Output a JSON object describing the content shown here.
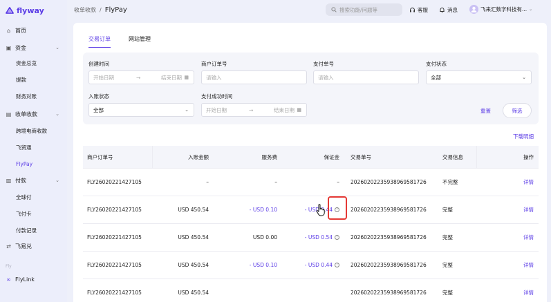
{
  "app": {
    "logo_text": "flyway"
  },
  "sidebar": {
    "items": [
      {
        "label": "首页",
        "icon": "home-icon",
        "kind": "top"
      },
      {
        "label": "资金",
        "icon": "wallet-icon",
        "kind": "group"
      },
      {
        "label": "资金总览",
        "kind": "sub"
      },
      {
        "label": "提款",
        "kind": "sub"
      },
      {
        "label": "财务对账",
        "kind": "sub"
      },
      {
        "label": "收单收款",
        "icon": "receipt-icon",
        "kind": "group"
      },
      {
        "label": "跨境电商收款",
        "kind": "sub"
      },
      {
        "label": "飞贸通",
        "kind": "sub"
      },
      {
        "label": "FlyPay",
        "kind": "sub",
        "active": true
      },
      {
        "label": "付款",
        "icon": "payment-icon",
        "kind": "group"
      },
      {
        "label": "全球付",
        "kind": "sub"
      },
      {
        "label": "飞付卡",
        "kind": "sub"
      },
      {
        "label": "付款记录",
        "kind": "sub"
      },
      {
        "label": "飞易兑",
        "icon": "exchange-icon",
        "kind": "top"
      }
    ],
    "section_label": "Fly",
    "flylink_label": "FlyLink"
  },
  "header": {
    "breadcrumb_parent": "收单收款",
    "breadcrumb_sep": "/",
    "breadcrumb_current": "FlyPay",
    "search_placeholder": "搜索功能/问题等",
    "support_label": "客服",
    "notice_label": "消息",
    "company_label": "飞来汇数字科技有..."
  },
  "tabs": [
    {
      "label": "交易订单",
      "active": true
    },
    {
      "label": "网站管理",
      "active": false
    }
  ],
  "filters": {
    "created_time_label": "创建时间",
    "start_placeholder": "开始日期",
    "range_arrow": "→",
    "end_placeholder": "结束日期",
    "merchant_order_label": "商户订单号",
    "merchant_order_placeholder": "请输入",
    "payment_no_label": "支付单号",
    "payment_no_placeholder": "请输入",
    "pay_status_label": "支付状态",
    "pay_status_value": "全部",
    "settle_status_label": "入账状态",
    "settle_status_value": "全部",
    "pay_success_time_label": "支付成功时间",
    "reset_label": "重置",
    "filter_label": "筛选"
  },
  "download_label": "下载明细",
  "table": {
    "columns": [
      "商户订单号",
      "入账金额",
      "服务费",
      "保证金",
      "交易单号",
      "交易信息",
      "操作"
    ],
    "rows": [
      {
        "order": "FLY26020221427105",
        "amount": "–",
        "fee": "–",
        "deposit": "–",
        "deposit_help": false,
        "txn": "20260202235938969581726",
        "info": "不完整",
        "op": "详情",
        "fee_purple": false,
        "deposit_purple": false
      },
      {
        "order": "FLY26020221427105",
        "amount": "USD 450.54",
        "fee": "- USD 0.10",
        "deposit": "- USD 0.44",
        "deposit_help": true,
        "txn": "20260202235938969581726",
        "info": "完整",
        "op": "详情",
        "fee_purple": true,
        "deposit_purple": true
      },
      {
        "order": "FLY26020221427105",
        "amount": "USD 450.54",
        "fee": "USD 0.00",
        "deposit": "- USD 0.54",
        "deposit_help": true,
        "txn": "20260202235938969581726",
        "info": "完整",
        "op": "详情",
        "fee_purple": false,
        "deposit_purple": true
      },
      {
        "order": "FLY26020221427105",
        "amount": "USD 450.54",
        "fee": "- USD 0.10",
        "deposit": "- USD 0.44",
        "deposit_help": true,
        "txn": "20260202235938969581726",
        "info": "完整",
        "op": "详情",
        "fee_purple": true,
        "deposit_purple": true
      },
      {
        "order": "FLY26020221427105",
        "amount": "USD 450.54",
        "fee": "",
        "deposit": "",
        "deposit_help": false,
        "txn": "20260202235938969581726",
        "info": "完整",
        "op": "详情",
        "fee_purple": false,
        "deposit_purple": false
      }
    ]
  },
  "colors": {
    "accent": "#5b3ce6",
    "highlight": "#e53935"
  }
}
